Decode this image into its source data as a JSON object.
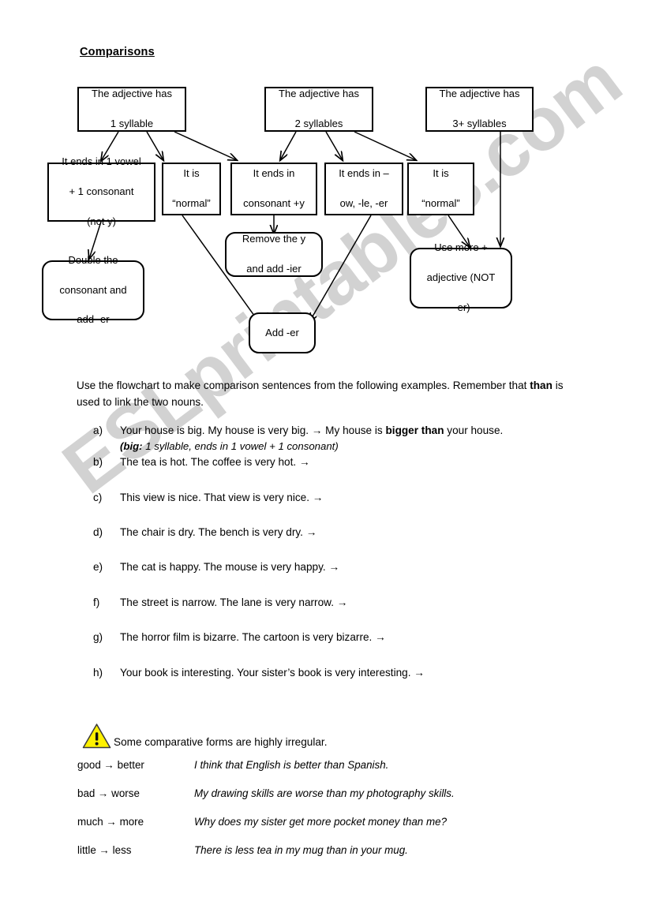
{
  "watermark": {
    "text": "ESLprintables.com",
    "color": "#d2d2d2"
  },
  "title": "Comparisons",
  "flowchart": {
    "nodes": {
      "syl1": {
        "line1": "The adjective has",
        "line2": "1 syllable"
      },
      "syl2": {
        "line1": "The adjective has",
        "line2": "2 syllables"
      },
      "syl3": {
        "line1": "The adjective has",
        "line2": "3+ syllables"
      },
      "vowel": {
        "line1": "It ends in 1 vowel",
        "line2": "+ 1 consonant",
        "line3": "(not y)"
      },
      "normal1": {
        "line1": "It is",
        "line2": "“normal”"
      },
      "consy": {
        "line1": "It ends in",
        "line2": "consonant +y"
      },
      "owleer": {
        "line1": "It ends in –",
        "line2": "ow, -le, -er"
      },
      "normal2": {
        "line1": "It is",
        "line2": "“normal”"
      },
      "double": {
        "line1": "Double the",
        "line2": "consonant and",
        "line3": "add -er"
      },
      "ier": {
        "line1": "Remove the y",
        "line2": "and add -ier"
      },
      "adder": {
        "line1": "Add -er"
      },
      "usemore": {
        "line1": "Use more +",
        "line2": "adjective (NOT",
        "line3": "–er)"
      }
    }
  },
  "intro": {
    "part1": "Use the flowchart to make comparison sentences from the following examples. Remember that ",
    "bold": "than",
    "part2": " is used to link the two nouns."
  },
  "exercises": [
    {
      "label": "a)",
      "text_before": "Your house is big. My house is very big. → My house is ",
      "bold": "bigger than",
      "text_after": " your house.",
      "note_bold": "(big:",
      "note_rest": " 1 syllable, ends in 1 vowel + 1 consonant)"
    },
    {
      "label": "b)",
      "text_before": "The tea is hot. The coffee is very hot. →",
      "bold": "",
      "text_after": ""
    },
    {
      "label": "c)",
      "text_before": "This view is nice. That view is very nice. →",
      "bold": "",
      "text_after": ""
    },
    {
      "label": "d)",
      "text_before": "The chair is dry. The bench is very dry. →",
      "bold": "",
      "text_after": ""
    },
    {
      "label": "e)",
      "text_before": "The cat is happy. The mouse is very happy. →",
      "bold": "",
      "text_after": ""
    },
    {
      "label": "f)",
      "text_before": "The street is narrow. The lane is very narrow. →",
      "bold": "",
      "text_after": ""
    },
    {
      "label": "g)",
      "text_before": "The horror film is bizarre. The cartoon is very bizarre. →",
      "bold": "",
      "text_after": ""
    },
    {
      "label": "h)",
      "text_before": "Your book is interesting. Your sister’s book is very interesting. →",
      "bold": "",
      "text_after": ""
    }
  ],
  "irregular": {
    "icon": "warning-triangle-icon",
    "icon_fill": "#FFF100",
    "heading": "Some comparative forms are highly irregular.",
    "rows": [
      {
        "form": "good → better",
        "sentence": "I think that English is better than Spanish."
      },
      {
        "form": "bad → worse",
        "sentence": "My drawing skills are worse than my photography skills."
      },
      {
        "form": "much → more",
        "sentence": "Why does my sister get more pocket money than me?"
      },
      {
        "form": "little → less",
        "sentence": "There is less tea in my mug than in your mug."
      }
    ]
  }
}
